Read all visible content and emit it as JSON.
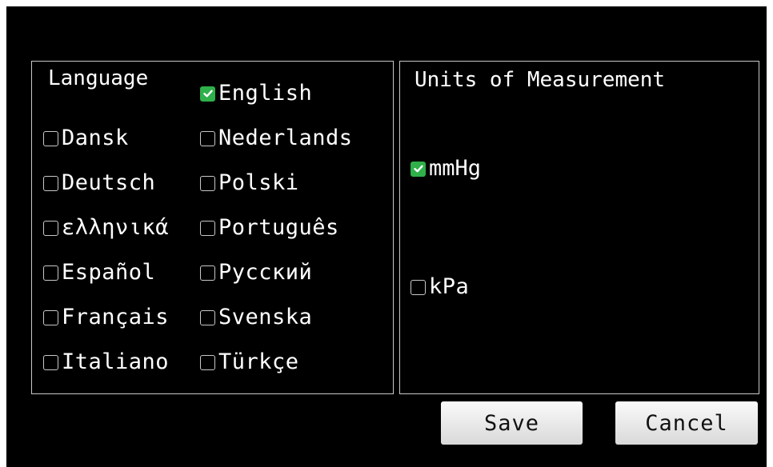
{
  "language_panel": {
    "title": "Language",
    "options": [
      {
        "label": "English",
        "checked": true
      },
      {
        "label": "Dansk",
        "checked": false
      },
      {
        "label": "Nederlands",
        "checked": false
      },
      {
        "label": "Deutsch",
        "checked": false
      },
      {
        "label": "Polski",
        "checked": false
      },
      {
        "label": "ελληνικά",
        "checked": false
      },
      {
        "label": "Português",
        "checked": false
      },
      {
        "label": "Español",
        "checked": false
      },
      {
        "label": "Русский",
        "checked": false
      },
      {
        "label": "Français",
        "checked": false
      },
      {
        "label": "Svenska",
        "checked": false
      },
      {
        "label": "Italiano",
        "checked": false
      },
      {
        "label": "Türkçe",
        "checked": false
      }
    ]
  },
  "units_panel": {
    "title": "Units of Measurement",
    "options": [
      {
        "label": "mmHg",
        "checked": true
      },
      {
        "label": "kPa",
        "checked": false
      }
    ]
  },
  "buttons": {
    "save": "Save",
    "cancel": "Cancel"
  },
  "colors": {
    "background": "#000000",
    "text": "#ffffff",
    "panel_border": "#c8c8c8",
    "checkbox_checked": "#2fb04a",
    "button_face": "#e8e8e8"
  },
  "icons": {
    "checked": "checkbox-checked-icon",
    "unchecked": "checkbox-unchecked-icon"
  }
}
